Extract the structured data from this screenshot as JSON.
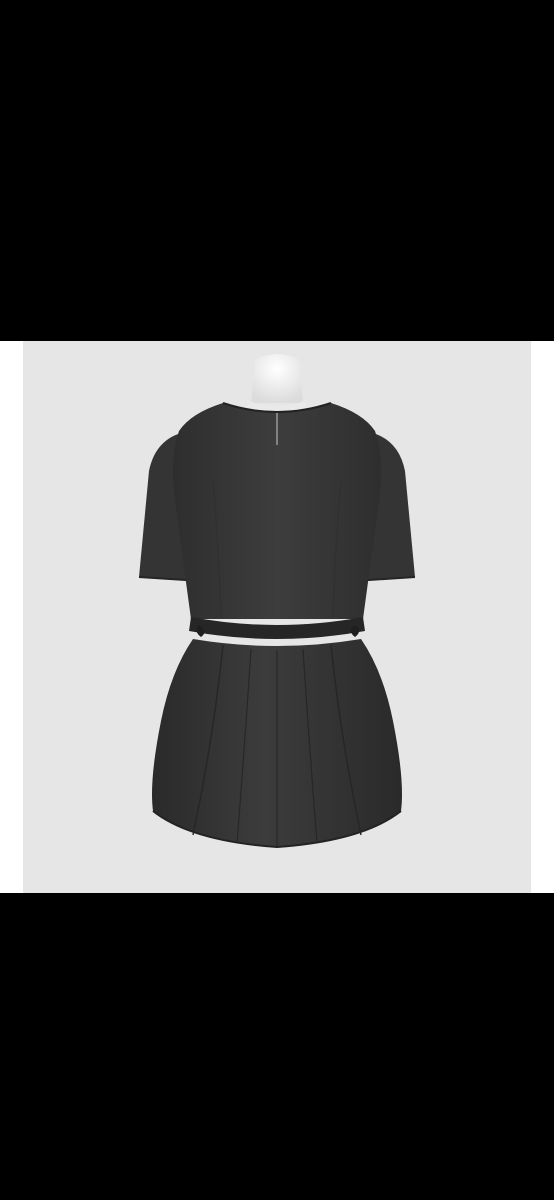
{
  "viewer": {
    "background_color": "#000000",
    "frame_color": "#ffffff",
    "photo_background_color": "#e6e6e6"
  },
  "photo": {
    "subject": "dress-back-view",
    "colors": {
      "mannequin": "#f2f2f2",
      "fabric": "#3a3a3a",
      "fabric_shadow": "#2b2b2b",
      "fabric_highlight": "#4a4a4a"
    }
  }
}
